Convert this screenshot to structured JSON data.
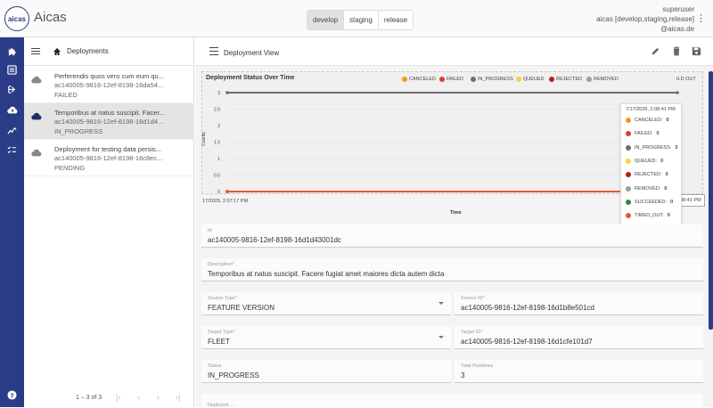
{
  "app": {
    "logo_text": "aicas",
    "title": "Aicas"
  },
  "environments": [
    {
      "label": "develop",
      "active": true
    },
    {
      "label": "staging",
      "active": false
    },
    {
      "label": "release",
      "active": false
    }
  ],
  "user": {
    "name": "superuser",
    "roles": "aicas [develop,staging,release]",
    "domain": "@aicas.de"
  },
  "rail_icons": [
    "puzzle-icon",
    "list-icon",
    "deploy-icon",
    "cloud-upload-icon",
    "trend-icon",
    "checklist-icon",
    "help-icon"
  ],
  "deployments_panel": {
    "title": "Deployments",
    "items": [
      {
        "title": "Perferendis quos vero cum eum qu...",
        "id": "ac140005-9816-12ef-8198-16da54...",
        "status": "FAILED",
        "selected": false
      },
      {
        "title": "Temporibus at natus suscipit. Facer...",
        "id": "ac140005-9816-12ef-8198-16d1d4...",
        "status": "IN_PROGRESS",
        "selected": true
      },
      {
        "title": "Deployment for testing data persis...",
        "id": "ac140005-9816-12ef-8198-16c8ec...",
        "status": "PENDING",
        "selected": false
      }
    ],
    "pagination": "1 – 3 of 3"
  },
  "view": {
    "title": "Deployment View"
  },
  "chart_data": {
    "type": "line",
    "title": "Deployment Status Over Time",
    "xlabel": "Time",
    "ylabel": "Counts",
    "ylim": [
      0,
      3
    ],
    "yticks": [
      "3",
      "2.5",
      "2",
      "1.5",
      "1",
      "0.5",
      "0"
    ],
    "x": [
      "7/17/2025, 2:07:17 PM",
      "7/17/2025, 2:08:41 PM"
    ],
    "x_start_label": "17/2025, 2:07:17 PM",
    "x_hover_label": "7/17/2025, 2:08:41 PM",
    "legend_position": "top-right",
    "legend_extra": "ILD OUT",
    "series": [
      {
        "name": "CANCELED",
        "color": "#f39c12",
        "values": [
          0,
          0
        ]
      },
      {
        "name": "FAILED",
        "color": "#e03a2f",
        "values": [
          0,
          0
        ]
      },
      {
        "name": "IN_PROGRESS",
        "color": "#6e6e6e",
        "values": [
          3,
          3
        ]
      },
      {
        "name": "QUEUED",
        "color": "#f5d23c",
        "values": [
          0,
          0
        ]
      },
      {
        "name": "REJECTED",
        "color": "#b71c1c",
        "values": [
          0,
          0
        ]
      },
      {
        "name": "REMOVED",
        "color": "#9e9e9e",
        "values": [
          0,
          0
        ]
      },
      {
        "name": "SUCCEEDED",
        "color": "#2e8b3d",
        "values": [
          0,
          0
        ]
      },
      {
        "name": "TIMED_OUT",
        "color": "#e8552f",
        "values": [
          0,
          0
        ]
      }
    ],
    "legend_visible": [
      "CANCELED",
      "FAILED",
      "IN_PROGRESS",
      "QUEUED",
      "REJECTED",
      "REMOVED"
    ],
    "tooltip": {
      "title": "7/17/2025, 2:08:41 PM",
      "rows": [
        {
          "name": "CANCELED:",
          "value": "0",
          "color": "#f39c12"
        },
        {
          "name": "FAILED:",
          "value": "0",
          "color": "#e03a2f"
        },
        {
          "name": "IN_PROGRESS:",
          "value": "3",
          "color": "#6e6e6e"
        },
        {
          "name": "QUEUED:",
          "value": "0",
          "color": "#f5d23c"
        },
        {
          "name": "REJECTED:",
          "value": "0",
          "color": "#b71c1c"
        },
        {
          "name": "REMOVED:",
          "value": "0",
          "color": "#9e9e9e"
        },
        {
          "name": "SUCCEEDED:",
          "value": "0",
          "color": "#2e8b3d"
        },
        {
          "name": "TIMED_OUT:",
          "value": "0",
          "color": "#e8552f"
        }
      ]
    }
  },
  "fields": {
    "id": {
      "label": "Id",
      "value": "ac140005-9816-12ef-8198-16d1d43001dc"
    },
    "description": {
      "label": "Description*",
      "value": "Temporibus at natus suscipit. Facere fugiat amet maiores dicta autem dicta"
    },
    "source_type": {
      "label": "Source Type*",
      "value": "FEATURE VERSION"
    },
    "source_id": {
      "label": "Source ID*",
      "value": "ac140005-9816-12ef-8198-16d1b8e501cd"
    },
    "target_type": {
      "label": "Target Type*",
      "value": "FLEET"
    },
    "target_id": {
      "label": "Target ID*",
      "value": "ac140005-9816-12ef-8198-16d1cfe101d7"
    },
    "status": {
      "label": "Status",
      "value": "IN_PROGRESS"
    },
    "total_runtimes": {
      "label": "Total Runtimes",
      "value": "3"
    },
    "cutoff": {
      "label": "Deployed ..."
    }
  },
  "colors": {
    "brand": "#2a3c86",
    "selected_row": "#e4e4e4"
  }
}
